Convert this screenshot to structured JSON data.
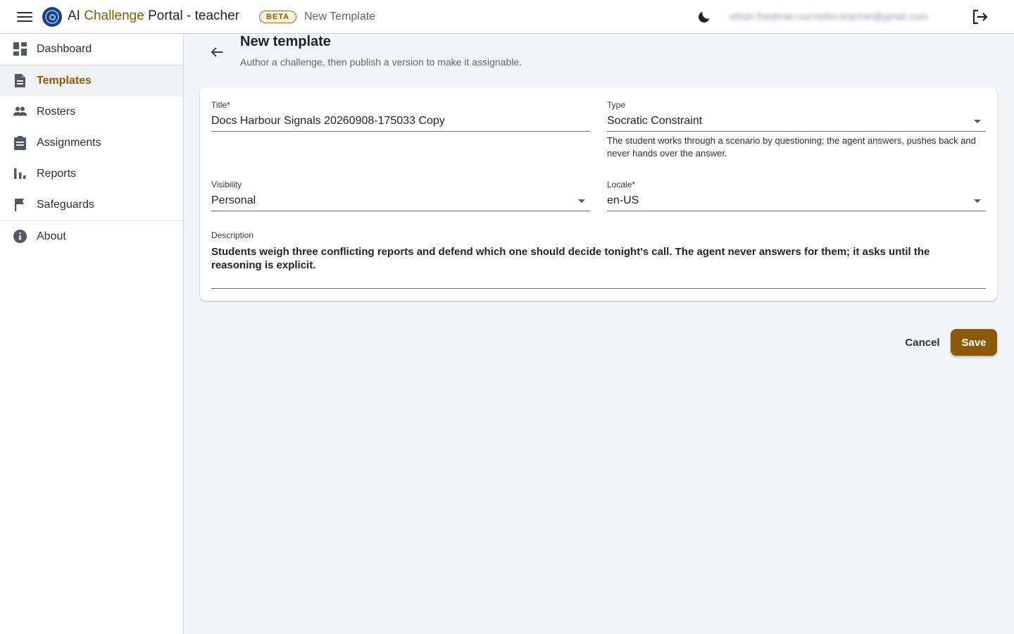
{
  "header": {
    "brand_ai": "AI",
    "brand_challenge": "Challenge",
    "brand_rest": "Portal - teacher",
    "beta": "BETA",
    "page_name": "New Template",
    "user_email": "ethan.friedman-sol.heller.teacher@gmail.com"
  },
  "sidebar": {
    "items": [
      {
        "label": "Dashboard",
        "icon": "dashboard-icon"
      },
      {
        "label": "Templates",
        "icon": "document-icon",
        "active": true
      },
      {
        "label": "Rosters",
        "icon": "people-icon"
      },
      {
        "label": "Assignments",
        "icon": "clipboard-icon"
      },
      {
        "label": "Reports",
        "icon": "bar-chart-icon"
      },
      {
        "label": "Safeguards",
        "icon": "flag-icon"
      },
      {
        "label": "About",
        "icon": "info-icon"
      }
    ]
  },
  "main": {
    "title": "New template",
    "subtitle": "Author a challenge, then publish a version to make it assignable."
  },
  "form": {
    "title_label": "Title*",
    "title_value": "Docs Harbour Signals 20260908-175033 Copy",
    "type_label": "Type",
    "type_value": "Socratic Constraint",
    "type_helper": "The student works through a scenario by questioning; the agent answers, pushes back and never hands over the answer.",
    "visibility_label": "Visibility",
    "visibility_value": "Personal",
    "locale_label": "Locale*",
    "locale_value": "en-US",
    "description_label": "Description",
    "description_value": "Students weigh three conflicting reports and defend which one should decide tonight's call. The agent never answers for them; it asks until the reasoning is explicit."
  },
  "actions": {
    "cancel": "Cancel",
    "save": "Save"
  },
  "colors": {
    "accent": "#8a5a08",
    "background": "#f4f5f8"
  }
}
